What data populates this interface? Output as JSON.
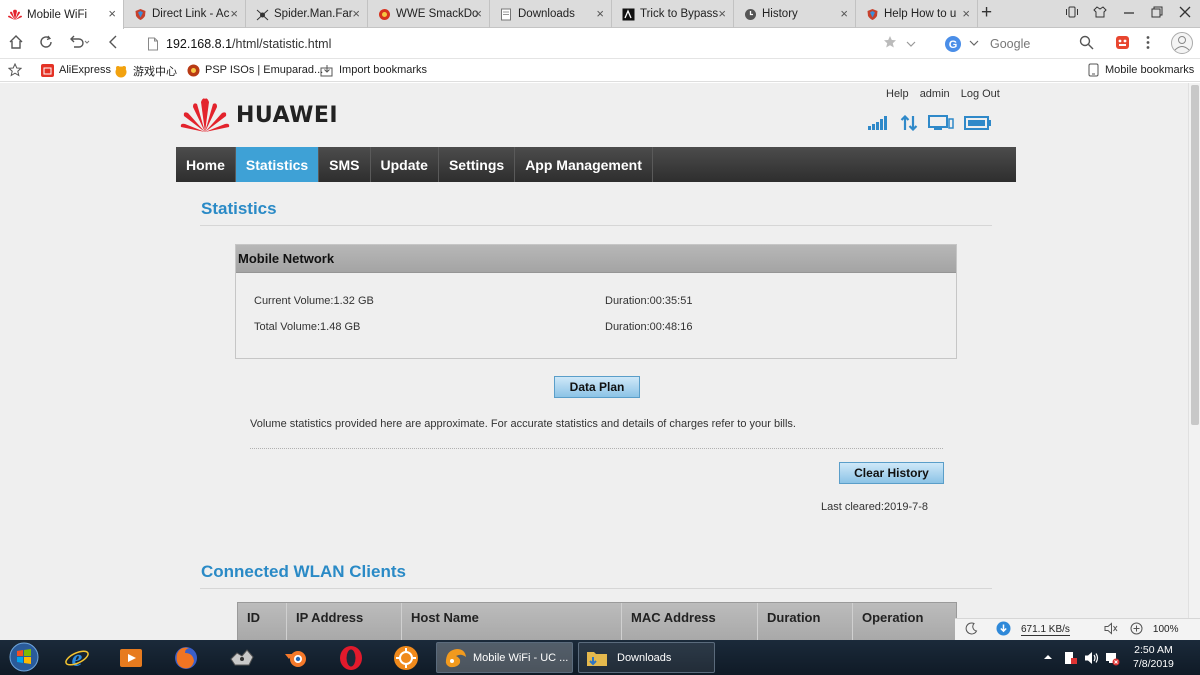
{
  "browser": {
    "tabs": [
      {
        "label": "Mobile WiFi",
        "icon": "huawei-icon",
        "active": true
      },
      {
        "label": "Direct Link - Ac",
        "icon": "shield-icon",
        "active": false
      },
      {
        "label": "Spider.Man.Far",
        "icon": "spider-icon",
        "active": false
      },
      {
        "label": "WWE SmackDo",
        "icon": "game-icon",
        "active": false
      },
      {
        "label": "Downloads",
        "icon": "page-icon",
        "active": false
      },
      {
        "label": "Trick to Bypass",
        "icon": "site-icon",
        "active": false
      },
      {
        "label": "History",
        "icon": "clock-icon",
        "active": false
      },
      {
        "label": "Help How to u",
        "icon": "shield-icon",
        "active": false
      }
    ],
    "close_glyph": "×",
    "new_tab_glyph": "+",
    "url_host": "192.168.8.1",
    "url_path": "/html/statistic.html",
    "search_placeholder": "Google",
    "bookmarks": [
      {
        "label": "AliExpress",
        "icon": "aliexpress-icon"
      },
      {
        "label": "游戏中心",
        "icon": "game-center-icon"
      },
      {
        "label": "PSP ISOs | Emuparad...",
        "icon": "emuparadise-icon"
      },
      {
        "label": "Import bookmarks",
        "icon": "import-icon"
      }
    ],
    "mobile_bookmarks": "Mobile bookmarks"
  },
  "router": {
    "brand": "HUAWEI",
    "top_links": [
      "Help",
      "admin",
      "Log Out"
    ],
    "nav": [
      {
        "label": "Home",
        "active": false
      },
      {
        "label": "Statistics",
        "active": true
      },
      {
        "label": "SMS",
        "active": false
      },
      {
        "label": "Update",
        "active": false
      },
      {
        "label": "Settings",
        "active": false
      },
      {
        "label": "App Management",
        "active": false
      }
    ],
    "statistics_title": "Statistics",
    "mobile_network": {
      "header": "Mobile Network",
      "current_volume": "Current Volume:1.32 GB",
      "current_duration": "Duration:00:35:51",
      "total_volume": "Total Volume:1.48 GB",
      "total_duration": "Duration:00:48:16"
    },
    "data_plan_button": "Data Plan",
    "volume_note": "Volume statistics provided here are approximate. For accurate statistics and details of charges refer to your bills.",
    "clear_history_button": "Clear History",
    "last_cleared": "Last cleared:2019-7-8",
    "wlan_title": "Connected WLAN Clients",
    "wlan_columns": [
      "ID",
      "IP Address",
      "Host Name",
      "MAC Address",
      "Duration",
      "Operation"
    ]
  },
  "system": {
    "download_speed": "671.1 KB/s",
    "zoom": "100%",
    "time": "2:50 AM",
    "date": "7/8/2019",
    "tasks": [
      {
        "label": "Mobile WiFi - UC ...",
        "icon": "uc-browser-icon",
        "active": true
      },
      {
        "label": "Downloads",
        "icon": "folder-icon",
        "active": false
      }
    ]
  },
  "colors": {
    "accent": "#3ea1d6",
    "title_blue": "#2a8ac6",
    "nav_bg": "#3a3a3a",
    "huawei_red": "#e3232c"
  }
}
